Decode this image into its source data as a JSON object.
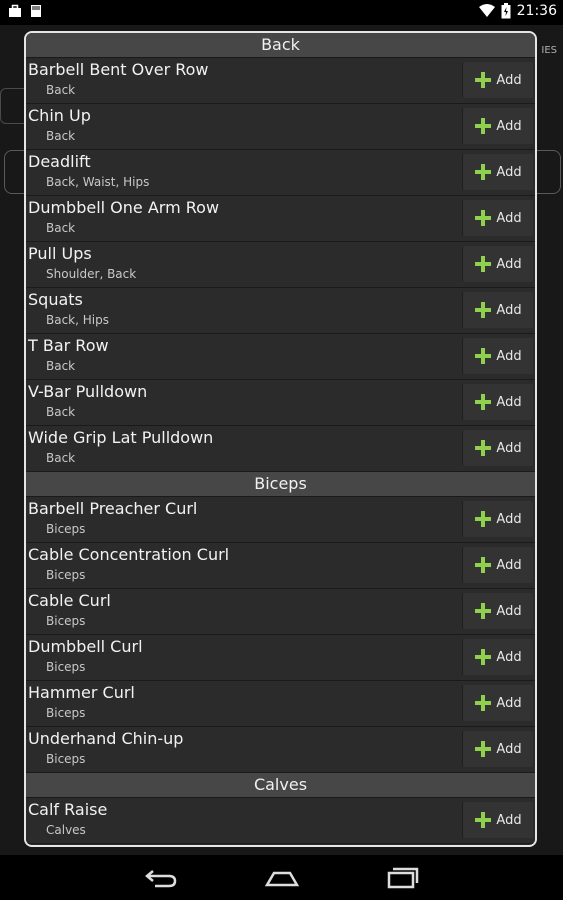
{
  "status_bar": {
    "time": "21:36"
  },
  "background": {
    "tab_text": "IES"
  },
  "sections": [
    {
      "title": "Back",
      "items": [
        {
          "name": "Barbell Bent Over Row",
          "muscles": "Back"
        },
        {
          "name": "Chin Up",
          "muscles": "Back"
        },
        {
          "name": "Deadlift",
          "muscles": "Back, Waist, Hips"
        },
        {
          "name": "Dumbbell One Arm Row",
          "muscles": "Back"
        },
        {
          "name": "Pull Ups",
          "muscles": "Shoulder, Back"
        },
        {
          "name": "Squats",
          "muscles": "Back, Hips"
        },
        {
          "name": "T Bar Row",
          "muscles": "Back"
        },
        {
          "name": "V-Bar Pulldown",
          "muscles": "Back"
        },
        {
          "name": "Wide Grip Lat Pulldown",
          "muscles": "Back"
        }
      ]
    },
    {
      "title": "Biceps",
      "items": [
        {
          "name": "Barbell Preacher Curl",
          "muscles": "Biceps"
        },
        {
          "name": "Cable Concentration Curl",
          "muscles": "Biceps"
        },
        {
          "name": "Cable Curl",
          "muscles": "Biceps"
        },
        {
          "name": "Dumbbell Curl",
          "muscles": "Biceps"
        },
        {
          "name": "Hammer Curl",
          "muscles": "Biceps"
        },
        {
          "name": "Underhand Chin-up",
          "muscles": "Biceps"
        }
      ]
    },
    {
      "title": "Calves",
      "items": [
        {
          "name": "Calf Raise",
          "muscles": "Calves"
        }
      ]
    }
  ],
  "add_label": "Add",
  "colors": {
    "accent_plus": "#8fd14f",
    "dialog_bg": "#2b2b2b",
    "header_bg": "#474747"
  }
}
